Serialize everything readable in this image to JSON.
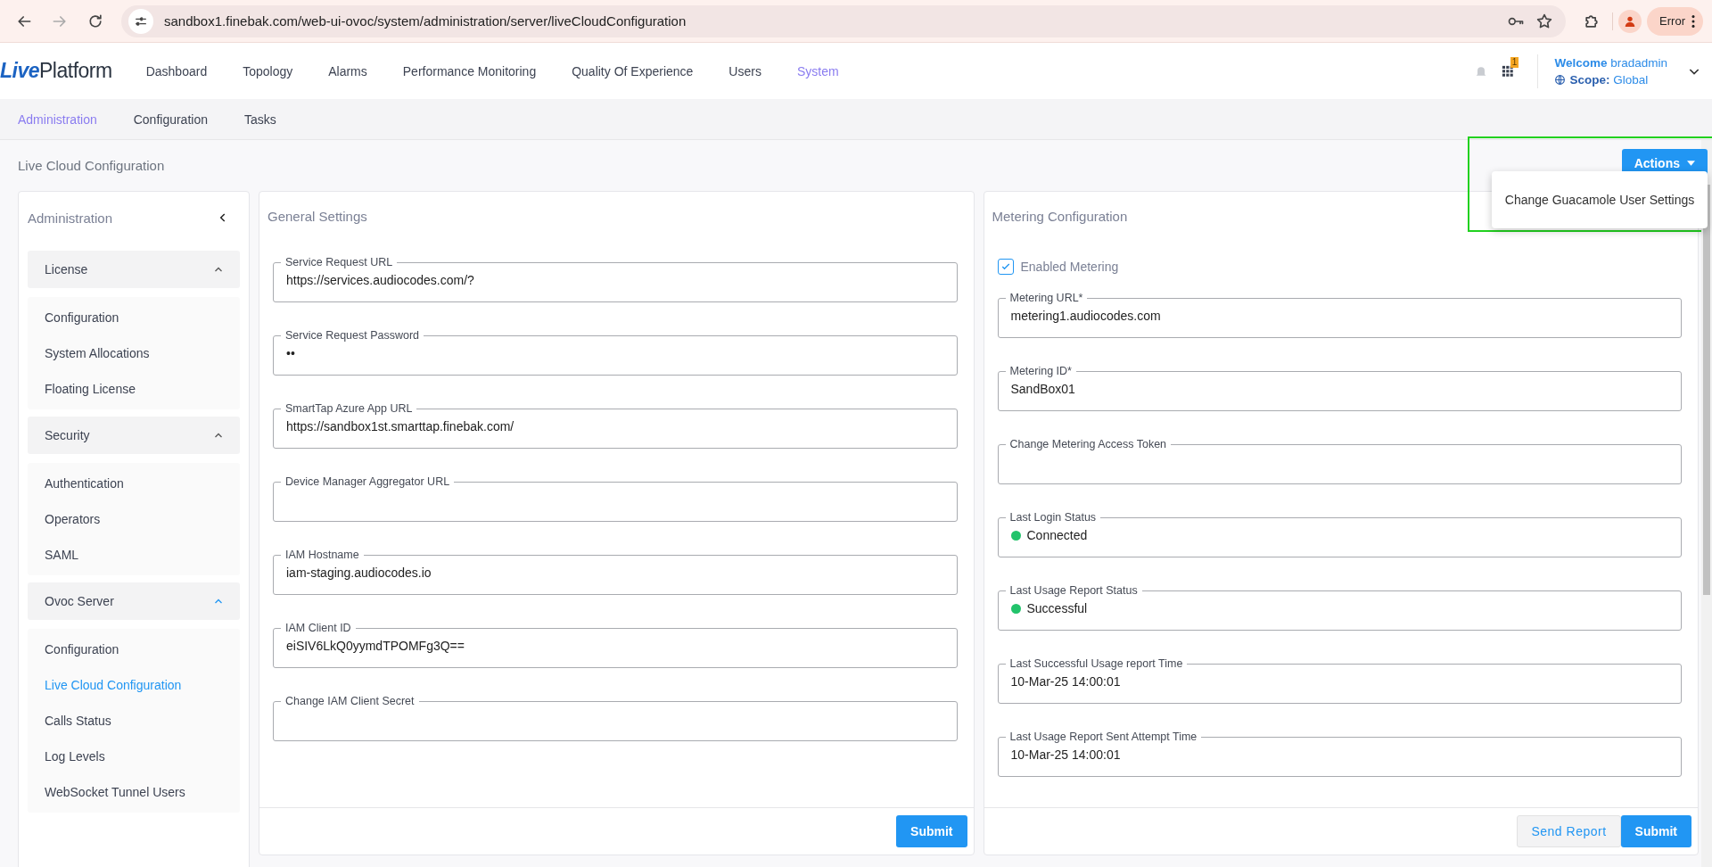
{
  "browser": {
    "url": "sandbox1.finebak.com/web-ui-ovoc/system/administration/server/liveCloudConfiguration",
    "profile_status": "Error"
  },
  "app": {
    "logo": {
      "prefix": "Live",
      "suffix": "Platform"
    },
    "nav": [
      {
        "label": "Dashboard",
        "selected": false
      },
      {
        "label": "Topology",
        "selected": false
      },
      {
        "label": "Alarms",
        "selected": false
      },
      {
        "label": "Performance Monitoring",
        "selected": false
      },
      {
        "label": "Quality Of Experience",
        "selected": false
      },
      {
        "label": "Users",
        "selected": false
      },
      {
        "label": "System",
        "selected": true
      }
    ],
    "alerts_badge": "1",
    "user": {
      "welcome_label": "Welcome",
      "username": "bradadmin",
      "scope_label": "Scope:",
      "scope_value": "Global"
    }
  },
  "subnav": [
    {
      "label": "Administration",
      "selected": true
    },
    {
      "label": "Configuration",
      "selected": false
    },
    {
      "label": "Tasks",
      "selected": false
    }
  ],
  "page_title": "Live Cloud Configuration",
  "actions": {
    "label": "Actions",
    "menu": [
      "Change Guacamole User Settings"
    ]
  },
  "sidebar": {
    "title": "Administration",
    "groups": [
      {
        "label": "License",
        "expanded": true,
        "items": [
          {
            "label": "Configuration",
            "selected": false
          },
          {
            "label": "System Allocations",
            "selected": false
          },
          {
            "label": "Floating License",
            "selected": false
          }
        ]
      },
      {
        "label": "Security",
        "expanded": true,
        "items": [
          {
            "label": "Authentication",
            "selected": false
          },
          {
            "label": "Operators",
            "selected": false
          },
          {
            "label": "SAML",
            "selected": false
          }
        ]
      },
      {
        "label": "Ovoc Server",
        "expanded": true,
        "items": [
          {
            "label": "Configuration",
            "selected": false
          },
          {
            "label": "Live Cloud Configuration",
            "selected": true
          },
          {
            "label": "Calls Status",
            "selected": false
          },
          {
            "label": "Log Levels",
            "selected": false
          },
          {
            "label": "WebSocket Tunnel Users",
            "selected": false
          }
        ]
      }
    ]
  },
  "general_settings": {
    "title": "General Settings",
    "fields": [
      {
        "label": "Service Request URL",
        "value": "https://services.audiocodes.com/?"
      },
      {
        "label": "Service Request Password",
        "value": "••"
      },
      {
        "label": "SmartTap Azure App URL",
        "value": "https://sandbox1st.smarttap.finebak.com/"
      },
      {
        "label": "Device Manager Aggregator URL"
      },
      {
        "label": "IAM Hostname",
        "value": "iam-staging.audiocodes.io"
      },
      {
        "label": "IAM Client ID",
        "value": "eiSIV6LkQ0yymdTPOMFg3Q=="
      },
      {
        "label": "Change IAM Client Secret"
      }
    ],
    "submit": "Submit"
  },
  "metering": {
    "title": "Metering Configuration",
    "enabled": {
      "label": "Enabled Metering",
      "checked": true
    },
    "fields": [
      {
        "kind": "text",
        "label": "Metering URL*",
        "value": "metering1.audiocodes.com"
      },
      {
        "kind": "text",
        "label": "Metering ID*",
        "value": "SandBox01"
      },
      {
        "kind": "text",
        "label": "Change Metering Access Token"
      },
      {
        "kind": "status",
        "label": "Last Login Status",
        "value": "Connected",
        "color": "#22c36b"
      },
      {
        "kind": "status",
        "label": "Last Usage Report Status",
        "value": "Successful",
        "color": "#22c36b"
      },
      {
        "kind": "text",
        "label": "Last Successful Usage report Time",
        "value": "10-Mar-25 14:00:01"
      },
      {
        "kind": "text",
        "label": "Last Usage Report Sent Attempt Time",
        "value": "10-Mar-25 14:00:01"
      }
    ],
    "send_report": "Send Report",
    "submit": "Submit"
  }
}
